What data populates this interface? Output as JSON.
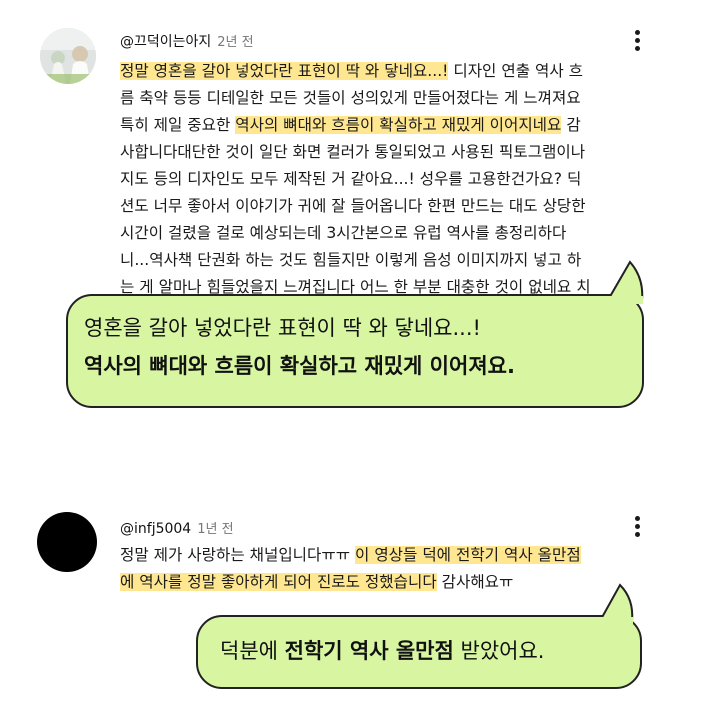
{
  "comments": [
    {
      "author": "@끄덕이는아지",
      "age": "2년 전",
      "lines": [
        [
          {
            "t": "정말 영혼을 갈아 넣었다란 표현이 딱 와 닿네요...!",
            "h": true
          },
          {
            "t": " 디자인 연출 역사 흐",
            "h": false
          }
        ],
        [
          {
            "t": "름 축약 등등 디테일한 모든 것들이 성의있게 만들어졌다는 게 느껴져요",
            "h": false
          }
        ],
        [
          {
            "t": "특히 제일 중요한 ",
            "h": false
          },
          {
            "t": "역사의 뼈대와 흐름이 확실하고 재밌게 이어지네요",
            "h": true
          },
          {
            "t": " 감",
            "h": false
          }
        ],
        [
          {
            "t": "사합니다대단한 것이 일단 화면 컬러가 통일되었고 사용된 픽토그램이나",
            "h": false
          }
        ],
        [
          {
            "t": "지도 등의 디자인도 모두 제작된 거 같아요...! 성우를 고용한건가요? 딕",
            "h": false
          }
        ],
        [
          {
            "t": "션도 너무 좋아서 이야기가 귀에 잘 들어옵니다 한편 만드는 대도 상당한",
            "h": false
          }
        ],
        [
          {
            "t": "시간이 걸렸을 걸로 예상되는데 3시간본으로 유럽 역사를 총정리하다",
            "h": false
          }
        ],
        [
          {
            "t": "니...역사책 단권화 하는 것도 힘들지만 이렇게 음성 이미지까지 넣고 하",
            "h": false
          }
        ],
        [
          {
            "t": "는 게 알마나 힘들었을지 느껴집니다 어느 한 부분 대충한 것이 없네요 치",
            "h": false
          }
        ]
      ],
      "callout": {
        "line1": "영혼을 갈아 넣었다란 표현이 딱 와 닿네요...!",
        "line2": "역사의 뼈대와 흐름이 확실하고 재밌게 이어져요."
      }
    },
    {
      "author": "@infj5004",
      "age": "1년 전",
      "lines": [
        [
          {
            "t": "정말 제가 사랑하는 채널입니다ㅠㅠ ",
            "h": false
          },
          {
            "t": "이 영상들 덕에 전학기 역사 올만점",
            "h": true
          }
        ],
        [
          {
            "t": "에 역사를 정말 좋아하게 되어 진로도 정했습니다",
            "h": true
          },
          {
            "t": " 감사해요ㅠ",
            "h": false
          }
        ]
      ],
      "callout": {
        "pre": "덕분에 ",
        "bold": "전학기 역사 올만점",
        "post": " 받았어요."
      }
    }
  ],
  "icons": {
    "menu": "more-vert-icon",
    "avatar1": "profile-photo",
    "avatar2": "profile-photo-black"
  },
  "colors": {
    "highlight": "#ffe792",
    "bubble": "#d8f6a2",
    "bubble_border": "#222222"
  }
}
